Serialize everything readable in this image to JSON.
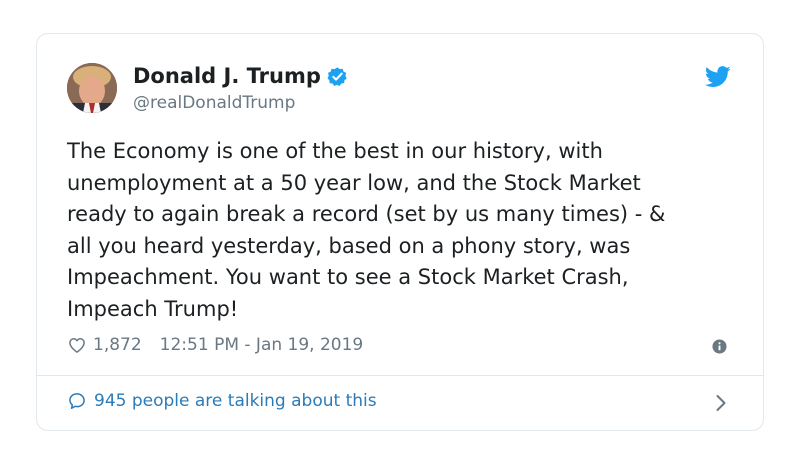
{
  "tweet": {
    "author_name": "Donald J. Trump",
    "handle": "@realDonaldTrump",
    "text": "The Economy is one of the best in our history, with\nunemployment at a 50 year low, and the Stock Market\nready to again break a record (set by us many times) - &\nall you heard yesterday, based on a phony story, was\nImpeachment. You want to see a Stock Market Crash,\nImpeach Trump!",
    "likes": "1,872",
    "timestamp": "12:51 PM - Jan 19, 2019",
    "talking_text": "945 people are talking about this"
  },
  "icons": {
    "avatar": "avatar",
    "verified": "verified-badge-icon",
    "brand": "twitter-bird-icon",
    "like": "heart-icon",
    "info": "info-icon",
    "conversation": "speech-bubble-icon",
    "chevron": "chevron-right-icon"
  },
  "colors": {
    "verified": "#1da1f2",
    "brand": "#1da1f2",
    "link": "#2b7bb9",
    "muted": "#697882",
    "text": "#1c2022",
    "border": "#e1e8ed"
  }
}
